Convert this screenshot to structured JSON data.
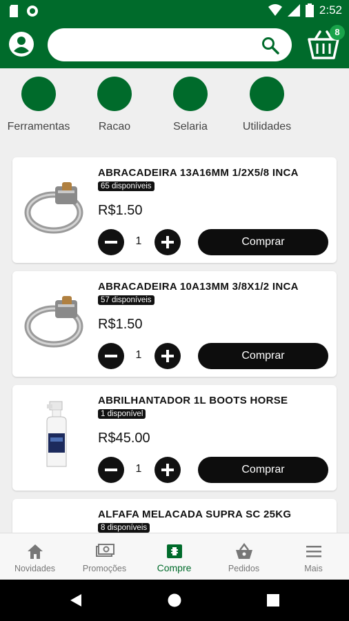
{
  "status_bar": {
    "time": "2:52"
  },
  "header": {
    "search": {
      "placeholder": "",
      "value": ""
    },
    "cart_count": "8"
  },
  "categories": [
    {
      "label": "Ferramentas"
    },
    {
      "label": "Racao"
    },
    {
      "label": "Selaria"
    },
    {
      "label": "Utilidades"
    }
  ],
  "products": [
    {
      "name": "ABRACADEIRA 13A16MM 1/2X5/8  INCA",
      "stock": "65 disponíveis",
      "price": "R$1.50",
      "qty": "1",
      "buy_label": "Comprar",
      "image": "hose-clamp"
    },
    {
      "name": "ABRACADEIRA 10A13MM 3/8X1/2 INCA",
      "stock": "57 disponíveis",
      "price": "R$1.50",
      "qty": "1",
      "buy_label": "Comprar",
      "image": "hose-clamp"
    },
    {
      "name": "ABRILHANTADOR 1L BOOTS HORSE",
      "stock": "1 disponível",
      "price": "R$45.00",
      "qty": "1",
      "buy_label": "Comprar",
      "image": "spray-bottle"
    },
    {
      "name": "ALFAFA MELACADA SUPRA SC 25KG",
      "stock": "8 disponíveis",
      "price": "",
      "qty": "",
      "buy_label": "",
      "image": "feed-bag"
    }
  ],
  "bottom_nav": [
    {
      "label": "Novidades",
      "icon": "home-icon"
    },
    {
      "label": "Promoções",
      "icon": "money-icon"
    },
    {
      "label": "Compre",
      "icon": "store-icon",
      "active": true
    },
    {
      "label": "Pedidos",
      "icon": "basket-icon"
    },
    {
      "label": "Mais",
      "icon": "menu-icon"
    }
  ],
  "colors": {
    "brand_green": "#006b2b",
    "badge_green": "#19a34a",
    "button_black": "#0d0d0d"
  }
}
